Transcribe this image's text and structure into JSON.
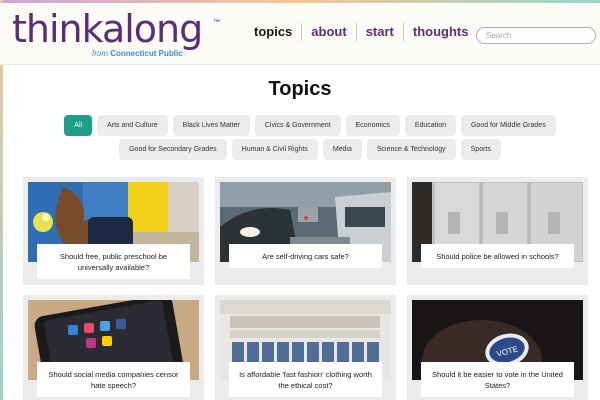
{
  "header": {
    "logo": {
      "text": "thinkalong",
      "tm": "™",
      "from": "from",
      "org": "Connecticut Public"
    },
    "nav": [
      "topics",
      "about",
      "start",
      "thoughts"
    ],
    "search_placeholder": "Search"
  },
  "page": {
    "title": "Topics"
  },
  "filters": {
    "row1": [
      "All",
      "Arts and Culture",
      "Black Lives Matter",
      "Civics & Government",
      "Economics",
      "Education",
      "Good for Middle Grades"
    ],
    "row2": [
      "Good for Secondary Grades",
      "Human & Civil Rights",
      "Media",
      "Science & Technology",
      "Sports"
    ],
    "active": "All"
  },
  "cards": [
    {
      "title": "Should free, public preschool be universally available?",
      "icon": "preschool-classroom-image"
    },
    {
      "title": "Are self-driving cars safe?",
      "icon": "cars-in-traffic-image"
    },
    {
      "title": "Should police be allowed in schools?",
      "icon": "school-lockers-image"
    },
    {
      "title": "Should social media companies censor hate speech?",
      "icon": "smartphone-apps-image"
    },
    {
      "title": "Is affordable 'fast fashion' clothing worth the ethical cost?",
      "icon": "clothing-store-image"
    },
    {
      "title": "Should it be easier to vote in the United States?",
      "icon": "vote-sticker-image"
    }
  ],
  "colors": {
    "brand": "#5a2f7a",
    "accent": "#1e9e8b",
    "link": "#3b8fd6"
  }
}
